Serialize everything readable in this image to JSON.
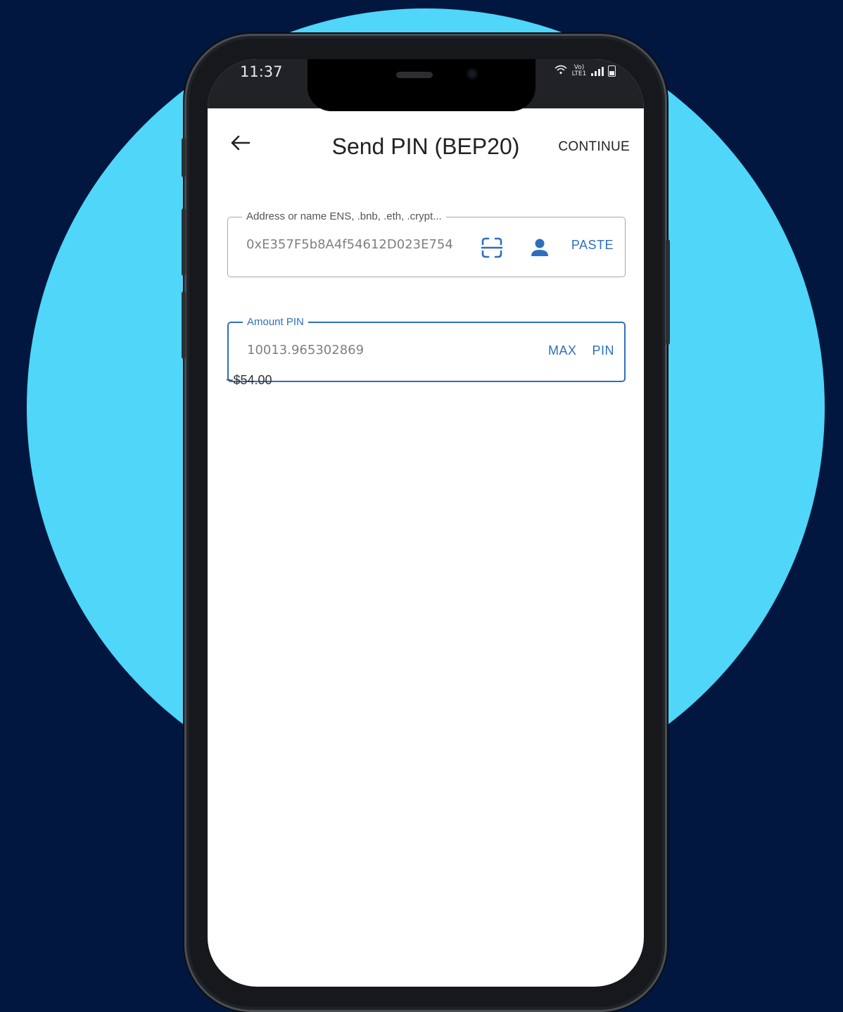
{
  "status_bar": {
    "time": "11:37",
    "network_label": "Vo) LTE1"
  },
  "header": {
    "title": "Send PIN (BEP20)",
    "continue_label": "CONTINUE"
  },
  "address_field": {
    "label": "Address or name ENS, .bnb, .eth, .crypt...",
    "value": "0xE357F5b8A4f54612D023E754",
    "paste_label": "PASTE"
  },
  "amount_field": {
    "label": "Amount PIN",
    "value": "10013.965302869",
    "max_label": "MAX",
    "currency_label": "PIN"
  },
  "fiat_estimate": "~$54.00",
  "colors": {
    "accent": "#2e6fbd",
    "background": "#02173f",
    "circle": "#4fd6f9"
  }
}
